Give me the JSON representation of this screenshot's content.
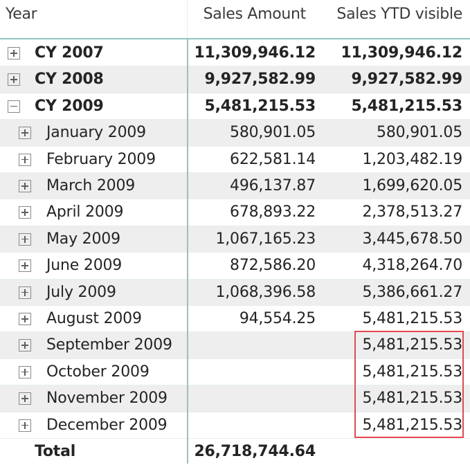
{
  "headers": {
    "year": "Year",
    "sales_amount": "Sales Amount",
    "sales_ytd": "Sales YTD visible"
  },
  "rows": [
    {
      "label": "CY 2007",
      "sales": "11,309,946.12",
      "ytd": "11,309,946.12",
      "level": 0,
      "expanded": false,
      "bold": true
    },
    {
      "label": "CY 2008",
      "sales": "9,927,582.99",
      "ytd": "9,927,582.99",
      "level": 0,
      "expanded": false,
      "bold": true
    },
    {
      "label": "CY 2009",
      "sales": "5,481,215.53",
      "ytd": "5,481,215.53",
      "level": 0,
      "expanded": true,
      "bold": true
    },
    {
      "label": "January 2009",
      "sales": "580,901.05",
      "ytd": "580,901.05",
      "level": 1,
      "expanded": false,
      "bold": false
    },
    {
      "label": "February 2009",
      "sales": "622,581.14",
      "ytd": "1,203,482.19",
      "level": 1,
      "expanded": false,
      "bold": false
    },
    {
      "label": "March 2009",
      "sales": "496,137.87",
      "ytd": "1,699,620.05",
      "level": 1,
      "expanded": false,
      "bold": false
    },
    {
      "label": "April 2009",
      "sales": "678,893.22",
      "ytd": "2,378,513.27",
      "level": 1,
      "expanded": false,
      "bold": false
    },
    {
      "label": "May 2009",
      "sales": "1,067,165.23",
      "ytd": "3,445,678.50",
      "level": 1,
      "expanded": false,
      "bold": false
    },
    {
      "label": "June 2009",
      "sales": "872,586.20",
      "ytd": "4,318,264.70",
      "level": 1,
      "expanded": false,
      "bold": false
    },
    {
      "label": "July 2009",
      "sales": "1,068,396.58",
      "ytd": "5,386,661.27",
      "level": 1,
      "expanded": false,
      "bold": false
    },
    {
      "label": "August 2009",
      "sales": "94,554.25",
      "ytd": "5,481,215.53",
      "level": 1,
      "expanded": false,
      "bold": false
    },
    {
      "label": "September 2009",
      "sales": "",
      "ytd": "5,481,215.53",
      "level": 1,
      "expanded": false,
      "bold": false
    },
    {
      "label": "October 2009",
      "sales": "",
      "ytd": "5,481,215.53",
      "level": 1,
      "expanded": false,
      "bold": false
    },
    {
      "label": "November 2009",
      "sales": "",
      "ytd": "5,481,215.53",
      "level": 1,
      "expanded": false,
      "bold": false
    },
    {
      "label": "December 2009",
      "sales": "",
      "ytd": "5,481,215.53",
      "level": 1,
      "expanded": false,
      "bold": false
    }
  ],
  "total": {
    "label": "Total",
    "sales": "26,718,744.64",
    "ytd": ""
  },
  "highlight": {
    "color": "#e8474e",
    "rows": [
      "September 2009",
      "October 2009",
      "November 2009",
      "December 2009"
    ],
    "column": "Sales YTD visible"
  },
  "colors": {
    "accent_line": "#8fc6bf",
    "row_shade": "#eeeeee",
    "text": "#252423"
  }
}
